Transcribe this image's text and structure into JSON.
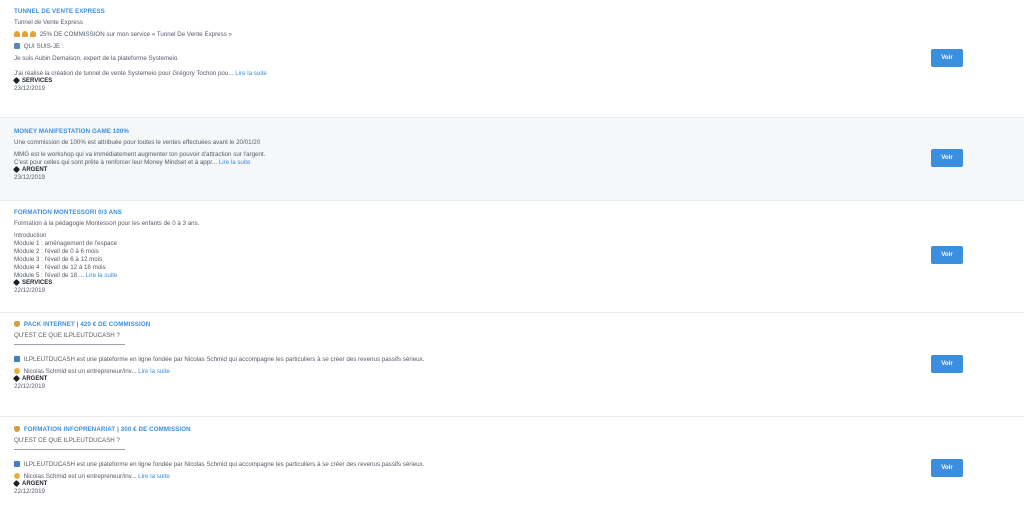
{
  "listings": [
    {
      "title": "TUNNEL DE VENTE EXPRESS",
      "subtitle": "Tunnel de Vente Express",
      "promo_icons": [
        "bell-icon",
        "bell-icon",
        "bell-icon"
      ],
      "promo_text": "25% DE COMMISSION sur mon service « Tunnel De Vente Express »",
      "who_label": "QUI SUIS-JE :",
      "intro": "Je suis Aubin Demaison, expert de la plateforme Systemeio.",
      "excerpt": "J'ai réalisé la création de tunnel de vente Systemeio pour Grégory Tochon pou...",
      "read_more": "Lire la suite",
      "category": "SERVICES",
      "date": "23/12/2019",
      "button": "Voir"
    },
    {
      "title": "MONEY MANIFESTATION GAME 100%",
      "line1": "Une commission de 100% est attribuée pour toutes le ventes effectuées avant le 20/01/20",
      "line2": "MMG est le workshop qui va immédiatement augmenter ton pouvoir d'attraction sur l'argent.",
      "excerpt": "C'est pour celles qui sont prête à renforcer leur Money Mindset et à appr...",
      "read_more": "Lire la suite",
      "category": "ARGENT",
      "date": "23/12/2019",
      "button": "Voir"
    },
    {
      "title": "FORMATION MONTESSORI 0/3 ANS",
      "line1": "Formation à la pédagogie Montessori pour les enfants de 0 à 3 ans.",
      "modules": [
        "Introduction",
        "Module 1 : aménagement de l'espace",
        "Module 2 : l'éveil de 0 à 6 mois",
        "Module 3 : l'éveil de 6 à 12 mois",
        "Module 4 : l'éveil de 12 à 18 mois"
      ],
      "excerpt": "Module 5 : l'éveil de 18 ...",
      "read_more": "Lire la suite",
      "category": "SERVICES",
      "date": "22/12/2019",
      "button": "Voir"
    },
    {
      "title": "PACK INTERNET | 420 € DE COMMISSION",
      "question": "QU'EST CE QUE ILPLEUTDUCASH ?",
      "description": "ILPLEUTDUCASH est une plateforme en ligne fondée par Nicolas Schmid qui accompagne les particuliers à se créer des revenus passifs sérieux.",
      "excerpt": "Nicolas Schmid est un entrepreneur/inv...",
      "read_more": "Lire la suite",
      "category": "ARGENT",
      "date": "22/12/2019",
      "button": "Voir"
    },
    {
      "title": "FORMATION INFOPRENARIAT | 300 € DE COMMISSION",
      "question": "QU'EST CE QUE ILPLEUTDUCASH ?",
      "description": "ILPLEUTDUCASH est une plateforme en ligne fondée par Nicolas Schmid qui accompagne les particuliers à se créer des revenus passifs sérieux.",
      "excerpt": "Nicolas Schmid est un entrepreneur/inv...",
      "read_more": "Lire la suite",
      "category": "ARGENT",
      "date": "22/12/2019",
      "button": "Voir"
    }
  ],
  "colors": {
    "accent": "#3a8fde",
    "alt_row": "#f6f7f9",
    "text": "#555b66",
    "dark": "#1e2128"
  }
}
